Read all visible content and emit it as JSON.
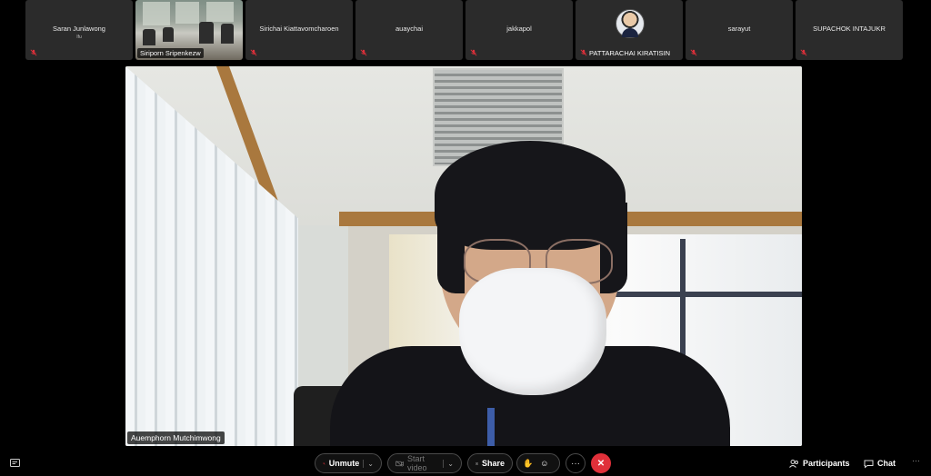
{
  "participants": [
    {
      "name": "Saran Junlawong",
      "sub": "Ifu",
      "type": "name"
    },
    {
      "name": "Siriporn Sripenkezw",
      "type": "video"
    },
    {
      "name": "Sirichai Kiattavomcharoen",
      "type": "name"
    },
    {
      "name": "auaychai",
      "type": "name"
    },
    {
      "name": "jakkapol",
      "type": "name"
    },
    {
      "name": "PATTARACHAI KIRATISIN",
      "type": "avatar"
    },
    {
      "name": "sarayut",
      "type": "name"
    },
    {
      "name": "SUPACHOK INTAJUKR",
      "type": "name"
    }
  ],
  "main_speaker": {
    "name": "Auemphorn Mutchimwong"
  },
  "toolbar": {
    "unmute": "Unmute",
    "start_video": "Start video",
    "share": "Share",
    "participants": "Participants",
    "chat": "Chat",
    "more": "···",
    "end": "✕"
  },
  "colors": {
    "end_call": "#e0303a",
    "muted_mic": "#e0303a",
    "tile_bg": "#2b2b2b"
  }
}
